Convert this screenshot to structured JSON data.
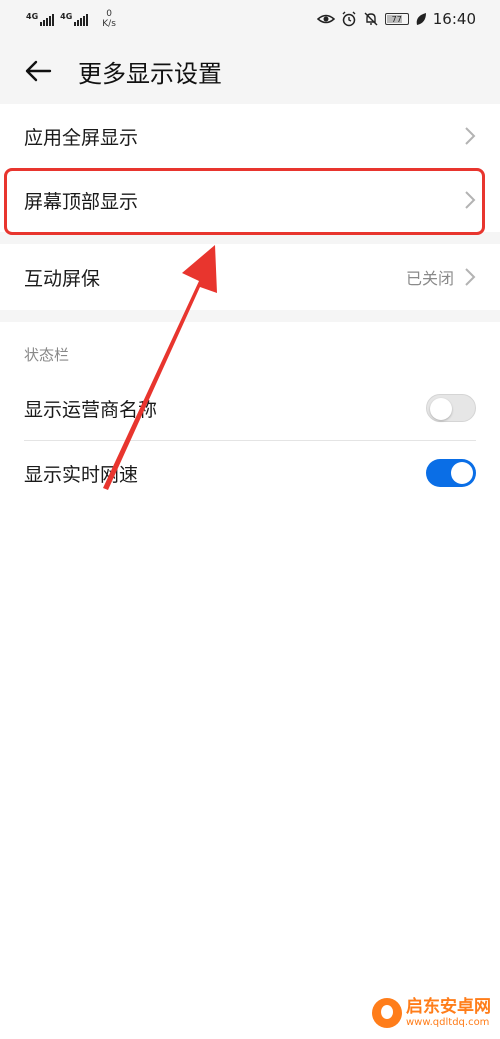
{
  "status_bar": {
    "network_1": "4G",
    "network_2": "4G",
    "speed_value": "0",
    "speed_unit": "K/s",
    "battery": "77",
    "time": "16:40",
    "icons": [
      "eye-icon",
      "alarm-icon",
      "mute-icon",
      "battery-icon",
      "leaf-icon"
    ]
  },
  "header": {
    "title": "更多显示设置",
    "back_icon": "arrow-left-icon"
  },
  "settings": {
    "fullscreen": {
      "label": "应用全屏显示"
    },
    "notch": {
      "label": "屏幕顶部显示"
    },
    "screensaver": {
      "label": "互动屏保",
      "value": "已关闭"
    }
  },
  "status_section": {
    "title": "状态栏",
    "carrier": {
      "label": "显示运营商名称",
      "enabled": false
    },
    "speed": {
      "label": "显示实时网速",
      "enabled": true
    }
  },
  "colors": {
    "accent": "#0a6ee6",
    "annotation_red": "#e8352e",
    "watermark_orange": "#ff7d1a"
  },
  "watermark": {
    "name": "启东安卓网",
    "url": "www.qdltdq.com"
  }
}
